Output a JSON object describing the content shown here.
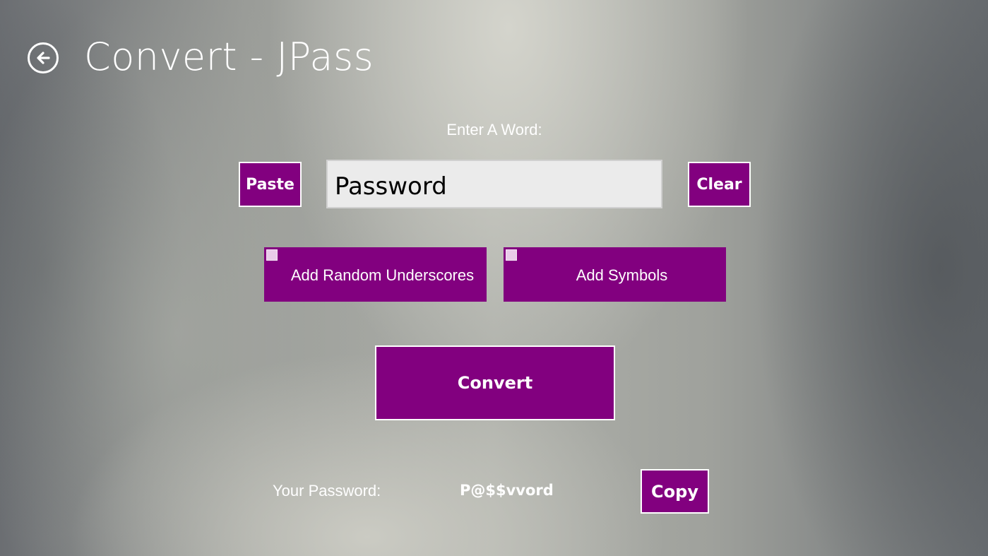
{
  "header": {
    "title": "Convert - JPass",
    "back_icon": "arrow-left-circle-icon"
  },
  "input_section": {
    "label": "Enter A Word:",
    "word_value": "Password",
    "paste_label": "Paste",
    "clear_label": "Clear"
  },
  "options": [
    {
      "label": "Add Random Underscores",
      "checked": false
    },
    {
      "label": "Add Symbols",
      "checked": false
    }
  ],
  "convert_label": "Convert",
  "result": {
    "label": "Your Password:",
    "value": "P@$$vvord",
    "copy_label": "Copy"
  },
  "colors": {
    "accent": "#82007f",
    "checkbox": "#e9cbe9",
    "input_bg": "#ebebeb"
  }
}
